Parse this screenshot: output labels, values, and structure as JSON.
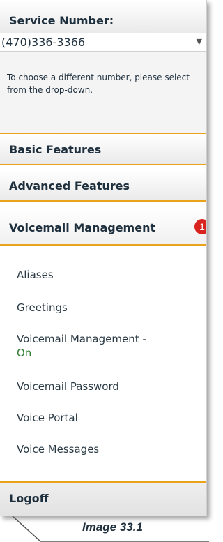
{
  "service_number": {
    "label": "Service Number:",
    "selected": "(470)336-3366",
    "helper": "To choose a different number, please select from the drop-down."
  },
  "sections": {
    "basic": "Basic Features",
    "advanced": "Advanced Features",
    "voicemail": "Voicemail Management"
  },
  "badge": "1",
  "submenu": {
    "aliases": "Aliases",
    "greetings": "Greetings",
    "vm_management": "Voicemail Management -",
    "vm_status": "On",
    "vm_password": "Voicemail Password",
    "voice_portal": "Voice Portal",
    "voice_messages": "Voice Messages"
  },
  "logoff": "Logoff",
  "caption": "Image 33.1",
  "colors": {
    "accent": "#e8a31a",
    "badge": "#d9231e",
    "text": "#1e2f3d",
    "status_on": "#2e7d2e"
  }
}
